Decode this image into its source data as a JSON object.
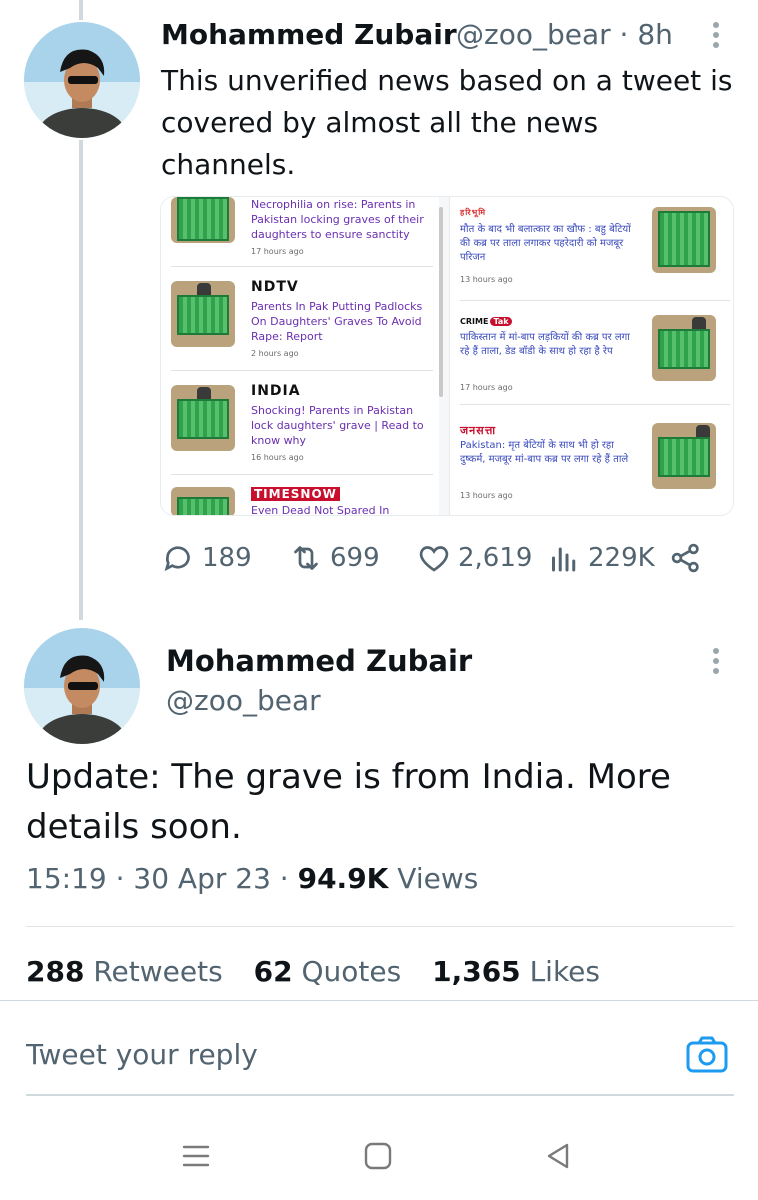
{
  "tweet1": {
    "name": "Mohammed Zubair",
    "handle_time": "@zoo_bear · 8h",
    "text": "This unverified news based on a tweet is covered by almost all the news channels.",
    "media": {
      "left": [
        {
          "brand": "",
          "headline": "Necrophilia on rise: Parents in Pakistan locking graves of their daughters to ensure sanctity",
          "age": "17 hours ago"
        },
        {
          "brand": "NDTV",
          "headline": "Parents In Pak Putting Padlocks On Daughters' Graves To Avoid Rape: Report",
          "age": "2 hours ago"
        },
        {
          "brand": "INDIA",
          "headline": "Shocking! Parents in Pakistan lock daughters' grave | Read to know why",
          "age": "16 hours ago"
        },
        {
          "brand": "TIMESNOW",
          "headline": "Even Dead Not Spared In",
          "age": ""
        }
      ],
      "right": [
        {
          "brand": "हरिभूमि",
          "headline": "मौत के बाद भी बलात्कार का खौफ : बहु बेटियों की कब्र पर ताला लगाकर पहरेदारी को मजबूर परिजन",
          "age": "13 hours ago"
        },
        {
          "brand": "CRIME",
          "badge": "Tak",
          "headline": "पाकिस्तान में मां-बाप लड़कियों की कब्र पर लगा रहे हैं ताला, डेड बॉडी के साथ हो रहा है रेप",
          "age": "17 hours ago"
        },
        {
          "brand": "जनसत्ता",
          "headline": "Pakistan: मृत बेटियों के साथ भी हो रहा दुष्कर्म, मजबूर मां-बाप कब्र पर लगा रहे हैं ताले",
          "age": "13 hours ago"
        }
      ]
    },
    "actions": {
      "replies": "189",
      "retweets": "699",
      "likes": "2,619",
      "views": "229K"
    }
  },
  "tweet2": {
    "name": "Mohammed Zubair",
    "handle": "@zoo_bear",
    "text": "Update: The grave is from India. More details soon.",
    "time": "15:19 · 30 Apr 23 · ",
    "views_count": "94.9K",
    "views_label": " Views",
    "stats": {
      "retweets_count": "288",
      "retweets_label": "Retweets",
      "quotes_count": "62",
      "quotes_label": "Quotes",
      "likes_count": "1,365",
      "likes_label": "Likes"
    }
  },
  "reply": {
    "placeholder": "Tweet your reply"
  },
  "colors": {
    "accent": "#1d9bf0",
    "secondary_text": "#536471",
    "primary_text": "#0f1419"
  },
  "icons": [
    "reply-icon",
    "retweet-icon",
    "like-icon",
    "views-icon",
    "share-icon",
    "camera-icon",
    "more-icon",
    "menu-icon",
    "home-icon",
    "back-icon"
  ]
}
